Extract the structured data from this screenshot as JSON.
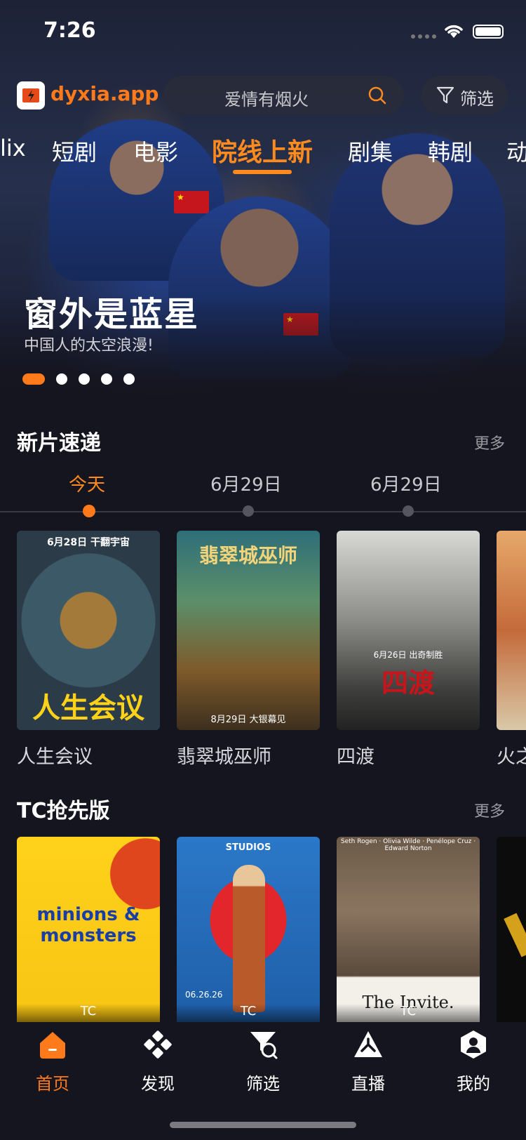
{
  "status_bar": {
    "time": "7:26"
  },
  "header": {
    "brand": "dyxia.app",
    "search_placeholder": "爱情有烟火",
    "filter_label": "筛选"
  },
  "categories": [
    {
      "label": "lix"
    },
    {
      "label": "短剧"
    },
    {
      "label": "电影"
    },
    {
      "label": "院线上新"
    },
    {
      "label": "剧集"
    },
    {
      "label": "韩剧"
    },
    {
      "label": "动"
    }
  ],
  "hero": {
    "title": "窗外是蓝星",
    "subtitle": "中国人的太空浪漫!",
    "carousel_index": 1,
    "carousel_count": 5
  },
  "new_releases": {
    "title": "新片速递",
    "more": "更多",
    "dates": [
      "今天",
      "6月29日",
      "6月29日"
    ],
    "items": [
      {
        "title": "人生会议",
        "poster_text": "人生会议",
        "poster_sub": "6月28日 干翻宇宙"
      },
      {
        "title": "翡翠城巫师",
        "poster_text": "翡翠城巫师",
        "poster_sub": "8月29日 大银幕见"
      },
      {
        "title": "四渡",
        "poster_text": "四渡",
        "poster_sub": "6月26日 出奇制胜"
      },
      {
        "title": "火之"
      }
    ]
  },
  "tc_section": {
    "title": "TC抢先版",
    "more": "更多",
    "items": [
      {
        "poster_text": "minions & monsters",
        "tag": "TC"
      },
      {
        "poster_text": "STUDIOS",
        "poster_sub": "06.26.26",
        "tag": "TC"
      },
      {
        "poster_text": "The Invite.",
        "poster_sub": "Seth Rogen · Olivia Wilde · Penélope Cruz · Edward Norton",
        "tag": "TC"
      },
      {
        "poster_text": ""
      }
    ]
  },
  "tabbar": {
    "items": [
      {
        "label": "首页",
        "icon": "home-icon"
      },
      {
        "label": "发现",
        "icon": "discover-icon"
      },
      {
        "label": "筛选",
        "icon": "filter-icon"
      },
      {
        "label": "直播",
        "icon": "live-icon"
      },
      {
        "label": "我的",
        "icon": "profile-icon"
      }
    ],
    "active_index": 0
  },
  "colors": {
    "accent": "#ff7a1a",
    "background": "#15151f"
  }
}
